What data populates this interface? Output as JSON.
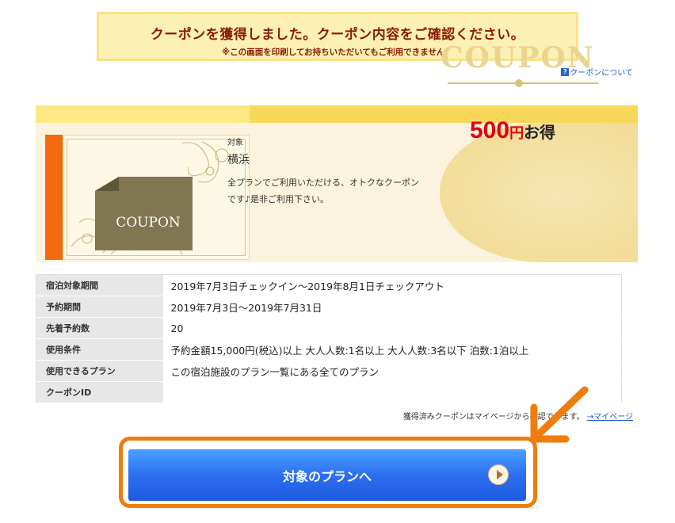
{
  "banner": {
    "title": "クーポンを獲得しました。クーポン内容をご確認ください。",
    "subtitle": "※この画面を印刷してお持ちいただいてもご利用できません。"
  },
  "about_link": {
    "icon": "question-icon",
    "label": "クーポンについて"
  },
  "coupon": {
    "image_text": "COUPON",
    "target_label": "対象",
    "target_value": "横浜",
    "description": "全プランでご利用いただける、オトクなクーポンです♪是非ご利用下さい。",
    "watermark": "COUPON",
    "amount": "500",
    "yen": "円",
    "deal": "お得"
  },
  "details": [
    {
      "label": "宿泊対象期間",
      "value": "2019年7月3日チェックイン〜2019年8月1日チェックアウト"
    },
    {
      "label": "予約期間",
      "value": "2019年7月3日〜2019年7月31日"
    },
    {
      "label": "先着予約数",
      "value": "20"
    },
    {
      "label": "使用条件",
      "value": "予約金額15,000円(税込)以上 大人人数:1名以上 大人人数:3名以下 泊数:1泊以上"
    },
    {
      "label": "使用できるプラン",
      "value": "この宿泊施設のプラン一覧にある全てのプラン"
    },
    {
      "label": "クーポンID",
      "value": ""
    }
  ],
  "mypage": {
    "note": "獲得済みクーポンはマイページから確認できます。",
    "link": "→マイページ"
  },
  "cta": {
    "label": "対象のプランへ",
    "icon": "play-icon"
  },
  "colors": {
    "accent_orange": "#f07c0b",
    "button_blue": "#2d6ff0",
    "price_red": "#e0000a"
  }
}
